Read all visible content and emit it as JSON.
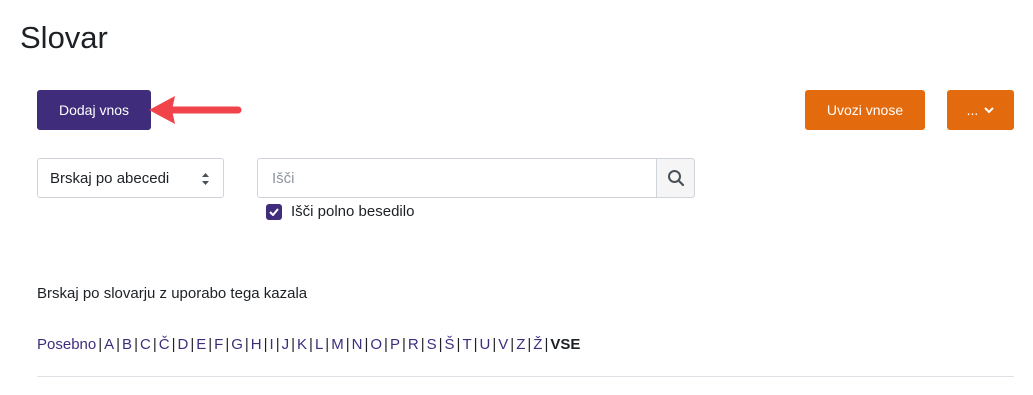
{
  "page": {
    "title": "Slovar"
  },
  "toolbar": {
    "add_entry_label": "Dodaj vnos",
    "import_label": "Uvozi vnose",
    "more_label": "..."
  },
  "colors": {
    "primary": "#3f2d7c",
    "accent": "#e46b0d",
    "annotation_arrow": "#f0434a"
  },
  "browse": {
    "mode_selected": "Brskaj po abecedi"
  },
  "search": {
    "placeholder": "Išči",
    "value": "",
    "fulltext_label": "Išči polno besedilo",
    "fulltext_checked": true
  },
  "index": {
    "intro": "Brskaj po slovarju z uporabo tega kazala",
    "letters": [
      "Posebno",
      "A",
      "B",
      "C",
      "Č",
      "D",
      "E",
      "F",
      "G",
      "H",
      "I",
      "J",
      "K",
      "L",
      "M",
      "N",
      "O",
      "P",
      "R",
      "S",
      "Š",
      "T",
      "U",
      "V",
      "Z",
      "Ž"
    ],
    "all_label": "VSE"
  },
  "icons": {
    "search": "search-icon",
    "caret": "chevron-down-icon",
    "select_arrows": "sort-updown-icon",
    "check": "check-icon"
  }
}
